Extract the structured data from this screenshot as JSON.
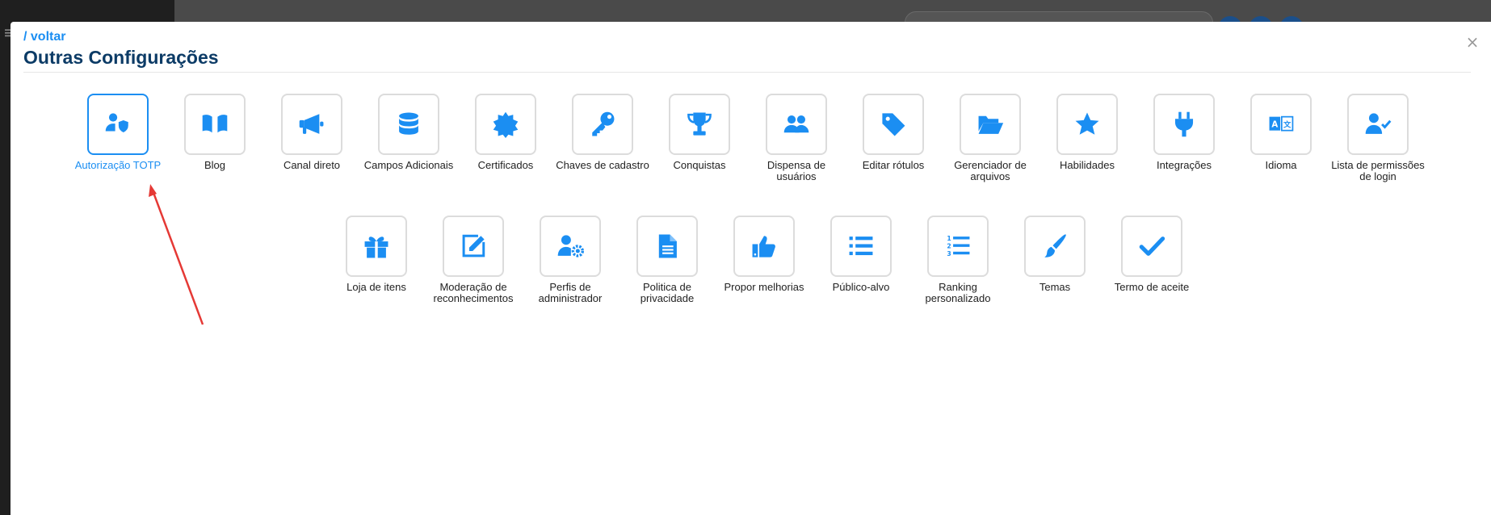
{
  "modal": {
    "back_link": "/ voltar",
    "title": "Outras Configurações",
    "close_glyph": "×"
  },
  "tiles_row1": [
    {
      "label": "Autorização TOTP",
      "icon": "user-shield-icon",
      "selected": true
    },
    {
      "label": "Blog",
      "icon": "book-open-icon"
    },
    {
      "label": "Canal direto",
      "icon": "bullhorn-icon"
    },
    {
      "label": "Campos Adicionais",
      "icon": "database-icon"
    },
    {
      "label": "Certificados",
      "icon": "certificate-icon"
    },
    {
      "label": "Chaves de cadastro",
      "icon": "key-icon"
    },
    {
      "label": "Conquistas",
      "icon": "trophy-icon"
    },
    {
      "label": "Dispensa de usuários",
      "icon": "users-icon"
    },
    {
      "label": "Editar rótulos",
      "icon": "tag-icon"
    },
    {
      "label": "Gerenciador de arquivos",
      "icon": "folder-open-icon"
    },
    {
      "label": "Habilidades",
      "icon": "star-icon"
    },
    {
      "label": "Integrações",
      "icon": "plug-icon"
    },
    {
      "label": "Idioma",
      "icon": "language-icon"
    },
    {
      "label": "Lista de permissões de login",
      "icon": "user-check-icon"
    }
  ],
  "tiles_row2": [
    {
      "label": "Loja de itens",
      "icon": "gift-icon"
    },
    {
      "label": "Moderação de reconhecimentos",
      "icon": "edit-icon"
    },
    {
      "label": "Perfis de administrador",
      "icon": "user-cog-icon"
    },
    {
      "label": "Politica de privacidade",
      "icon": "file-alt-icon"
    },
    {
      "label": "Propor melhorias",
      "icon": "thumbs-up-icon"
    },
    {
      "label": "Público-alvo",
      "icon": "list-icon"
    },
    {
      "label": "Ranking personalizado",
      "icon": "list-ol-icon"
    },
    {
      "label": "Temas",
      "icon": "paint-brush-icon"
    },
    {
      "label": "Termo de aceite",
      "icon": "check-icon"
    }
  ],
  "colors": {
    "accent": "#1b8ef2",
    "title": "#0c3b66",
    "annotation_arrow": "#e53935"
  }
}
